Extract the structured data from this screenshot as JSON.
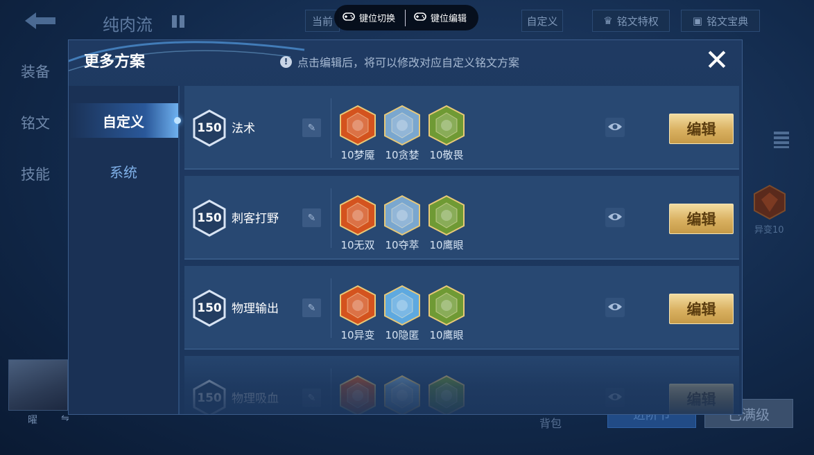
{
  "background": {
    "header_title": "纯肉流",
    "header_current": "当前",
    "custom_btn": "自定义",
    "privilege_btn": "铭文特权",
    "treasure_btn": "铭文宝典",
    "side_tabs": [
      "装备",
      "铭文",
      "技能"
    ],
    "right_rune_label": "异变10",
    "bottom_backpack": "背包",
    "bottom_btn1": "进阶节",
    "bottom_btn2": "已满级",
    "avatar_name": "曜"
  },
  "keybar": {
    "switch_label": "键位切换",
    "edit_label": "键位编辑"
  },
  "modal": {
    "title": "更多方案",
    "hint": "点击编辑后，将可以修改对应自定义铭文方案",
    "close_symbol": "✕",
    "tabs": [
      {
        "label": "自定义",
        "active": true
      },
      {
        "label": "系统",
        "active": false
      }
    ],
    "edit_label": "编辑",
    "rows": [
      {
        "level": "150",
        "name": "法术",
        "runes": [
          {
            "label": "10梦魇",
            "color": "#d4531e"
          },
          {
            "label": "10贪婪",
            "color": "#7aa7cf"
          },
          {
            "label": "10敬畏",
            "color": "#6f9a34"
          }
        ]
      },
      {
        "level": "150",
        "name": "刺客打野",
        "runes": [
          {
            "label": "10无双",
            "color": "#d4531e"
          },
          {
            "label": "10夺萃",
            "color": "#7aa7cf"
          },
          {
            "label": "10鹰眼",
            "color": "#6f9a34"
          }
        ]
      },
      {
        "level": "150",
        "name": "物理输出",
        "runes": [
          {
            "label": "10异变",
            "color": "#d4531e"
          },
          {
            "label": "10隐匿",
            "color": "#5ea9e0"
          },
          {
            "label": "10鹰眼",
            "color": "#6f9a34"
          }
        ]
      },
      {
        "level": "150",
        "name": "物理吸血",
        "runes": [
          {
            "label": "",
            "color": "#d4531e"
          },
          {
            "label": "",
            "color": "#7aa7cf"
          },
          {
            "label": "",
            "color": "#6f9a34"
          }
        ]
      }
    ]
  }
}
